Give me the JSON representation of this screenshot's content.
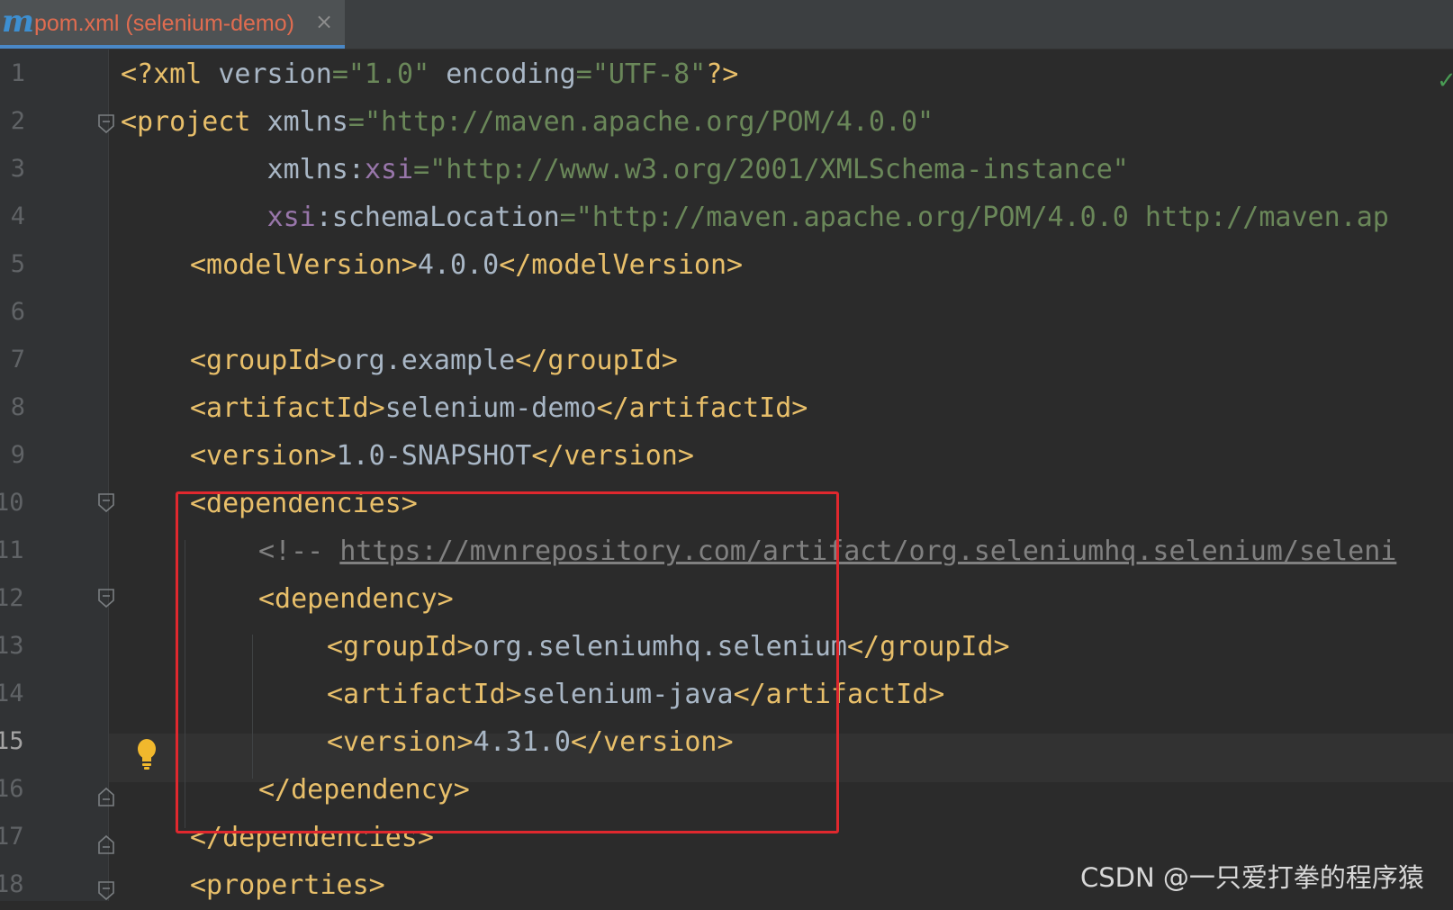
{
  "tab": {
    "icon": "maven-m-icon",
    "icon_letter": "m",
    "title": "pom.xml (selenium-demo)",
    "close": "×"
  },
  "gutter": {
    "line_numbers": [
      "1",
      "2",
      "3",
      "4",
      "5",
      "6",
      "7",
      "8",
      "9",
      "10",
      "11",
      "12",
      "13",
      "14",
      "15",
      "16",
      "17",
      "18"
    ],
    "current_line": "15"
  },
  "code": {
    "l1": {
      "open": "<?xml ",
      "a1": "version",
      "eq1": "=",
      "v1": "\"1.0\"",
      "sp": " ",
      "a2": "encoding",
      "eq2": "=",
      "v2": "\"UTF-8\"",
      "close": "?>"
    },
    "l2": {
      "open": "<project ",
      "a1": "xmlns",
      "eq": "=",
      "v": "\"http://maven.apache.org/POM/4.0.0\""
    },
    "l3": {
      "indent": "         ",
      "a1": "xmlns:",
      "ns": "xsi",
      "eq": "=",
      "v": "\"http://www.w3.org/2001/XMLSchema-instance\""
    },
    "l4": {
      "indent": "         ",
      "ns": "xsi",
      "a1": ":schemaLocation",
      "eq": "=",
      "v": "\"http://maven.apache.org/POM/4.0.0 http://maven.ap"
    },
    "l5": {
      "o": "<modelVersion>",
      "t": "4.0.0",
      "c": "</modelVersion>"
    },
    "l7": {
      "o": "<groupId>",
      "t": "org.example",
      "c": "</groupId>"
    },
    "l8": {
      "o": "<artifactId>",
      "t": "selenium-demo",
      "c": "</artifactId>"
    },
    "l9": {
      "o": "<version>",
      "t": "1.0-SNAPSHOT",
      "c": "</version>"
    },
    "l10": {
      "o": "<dependencies>"
    },
    "l11": {
      "cmt": "<!-- ",
      "url": "https://mvnrepository.com/artifact/org.seleniumhq.selenium/seleni"
    },
    "l12": {
      "o": "<dependency>"
    },
    "l13": {
      "o": "<groupId>",
      "t": "org.seleniumhq.selenium",
      "c": "</groupId>"
    },
    "l14": {
      "o": "<artifactId>",
      "t": "selenium-java",
      "c": "</artifactId>"
    },
    "l15": {
      "o": "<version>",
      "t": "4.31.0",
      "c": "</version>"
    },
    "l16": {
      "c": "</dependency>"
    },
    "l17": {
      "c": "</dependencies>"
    },
    "l18": {
      "o": "<properties>"
    }
  },
  "inspection": {
    "check": "✓"
  },
  "watermark": "CSDN @一只爱打拳的程序猿",
  "colors": {
    "tag": "#e8bf6a",
    "string": "#6a8759",
    "namespace": "#9876aa",
    "highlight_box": "#e0282e"
  }
}
